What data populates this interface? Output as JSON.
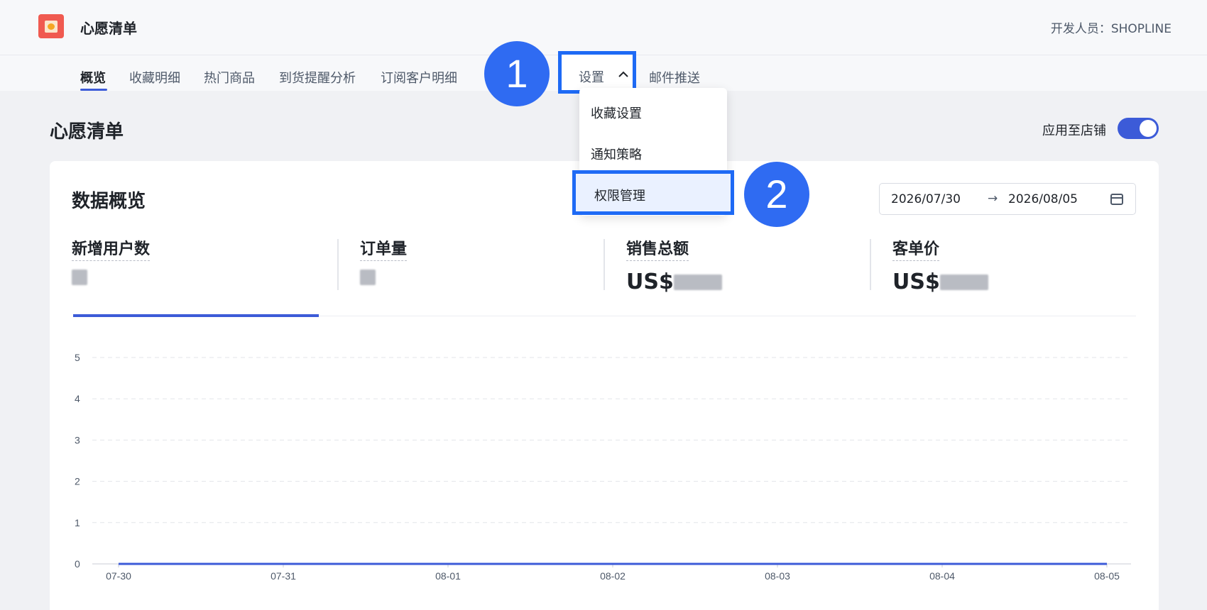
{
  "app": {
    "title": "心愿清单",
    "developer": "开发人员：SHOPLINE"
  },
  "tabs": [
    {
      "label": "概览",
      "active": true
    },
    {
      "label": "收藏明细"
    },
    {
      "label": "热门商品"
    },
    {
      "label": "到货提醒分析"
    },
    {
      "label": "订阅客户明细"
    }
  ],
  "settings_tab": {
    "label": "设置",
    "chevron": "^"
  },
  "email_tab": {
    "label": "邮件推送"
  },
  "callouts": {
    "step1": "1",
    "step2": "2"
  },
  "dropdown": {
    "items": [
      "收藏设置",
      "通知策略"
    ],
    "highlighted": "权限管理"
  },
  "page": {
    "title": "心愿清单",
    "apply_label": "应用至店铺",
    "apply_enabled": true
  },
  "overview": {
    "title": "数据概览",
    "date_start": "2026/07/30",
    "date_arrow": "→",
    "date_end": "2026/08/05",
    "metrics": [
      {
        "label": "新增用户数",
        "prefix": ""
      },
      {
        "label": "订单量",
        "prefix": ""
      },
      {
        "label": "销售总额",
        "prefix": "US$"
      },
      {
        "label": "客单价",
        "prefix": "US$"
      }
    ]
  },
  "chart_data": {
    "type": "line",
    "x": [
      "07-30",
      "07-31",
      "08-01",
      "08-02",
      "08-03",
      "08-04",
      "08-05"
    ],
    "series": [
      {
        "values": [
          0,
          0,
          0,
          0,
          0,
          0,
          0
        ],
        "color": "#3c5bd8"
      }
    ],
    "yticks": [
      "0",
      "1",
      "2",
      "3",
      "4",
      "5"
    ],
    "ylim": [
      0,
      5
    ],
    "grid": true
  },
  "colors": {
    "accent": "#3c5bd8",
    "callout": "#2f6bf2",
    "highlight_border": "#1e6af5"
  }
}
